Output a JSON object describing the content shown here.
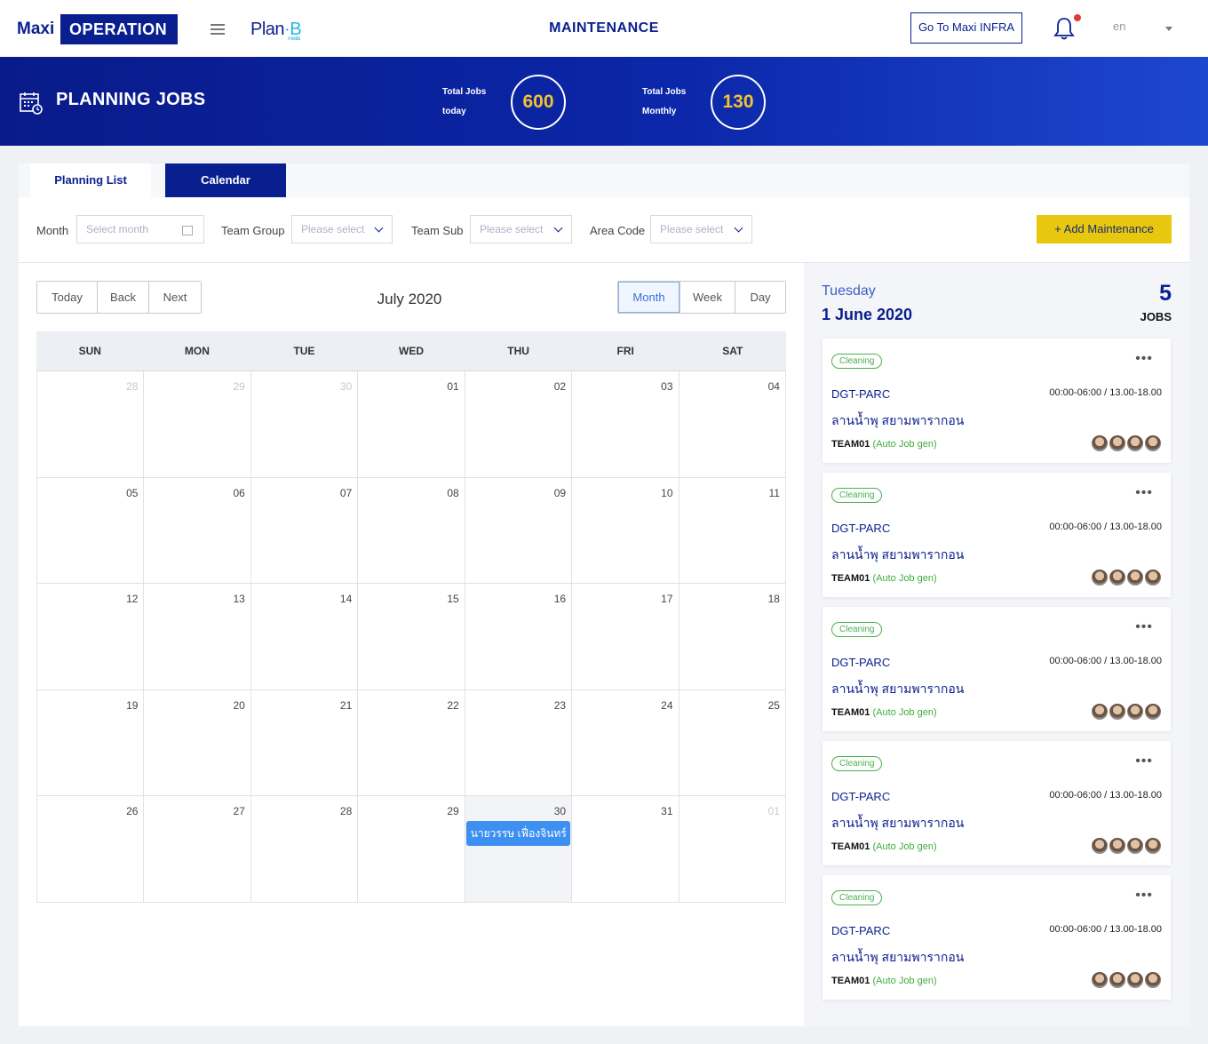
{
  "header": {
    "brand_maxi": "Maxi",
    "brand_operation": "OPERATION",
    "brand_planb": "Plan",
    "brand_planb_b": "B",
    "brand_planb_media": "media",
    "title": "MAINTENANCE",
    "infra_button": "Go To Maxi INFRA",
    "language": "en"
  },
  "banner": {
    "title": "PLANNING JOBS",
    "stats": [
      {
        "label_1": "Total Jobs",
        "label_2": "today",
        "value": "600"
      },
      {
        "label_1": "Total Jobs",
        "label_2": "Monthly",
        "value": "130"
      }
    ]
  },
  "tabs": [
    {
      "label": "Planning List"
    },
    {
      "label": "Calendar"
    }
  ],
  "filters": {
    "month_label": "Month",
    "month_placeholder": "Select month",
    "team_group_label": "Team  Group",
    "team_group_value": "Please  select",
    "team_sub_label": "Team  Sub",
    "team_sub_value": "Please  select",
    "area_code_label": "Area  Code",
    "area_code_value": "Please  select",
    "add_button": "+  Add Maintenance"
  },
  "calendar": {
    "nav": [
      "Today",
      "Back",
      "Next"
    ],
    "title": "July  2020",
    "views": [
      "Month",
      "Week",
      "Day"
    ],
    "active_view": "Month",
    "weekdays": [
      "SUN",
      "MON",
      "TUE",
      "WED",
      "THU",
      "FRI",
      "SAT"
    ],
    "weeks": [
      [
        "28",
        "29",
        "30",
        "01",
        "02",
        "03",
        "04"
      ],
      [
        "05",
        "06",
        "07",
        "08",
        "09",
        "10",
        "11"
      ],
      [
        "12",
        "13",
        "14",
        "15",
        "16",
        "17",
        "18"
      ],
      [
        "19",
        "20",
        "21",
        "22",
        "23",
        "24",
        "25"
      ],
      [
        "26",
        "27",
        "28",
        "29",
        "30",
        "31",
        "01"
      ]
    ],
    "event": "นายวรรษ เฟื่องจินทร์"
  },
  "side": {
    "day_name": "Tuesday",
    "date": "1  June  2020",
    "count": "5",
    "count_label": "JOBS",
    "jobs": [
      {
        "tag": "Cleaning",
        "code": "DGT-PARC",
        "time": "00:00-06:00  /  13.00-18.00",
        "location": "ลานน้ำพุ  สยามพารากอน",
        "team": "TEAM01",
        "auto": "(Auto  Job  gen)"
      },
      {
        "tag": "Cleaning",
        "code": "DGT-PARC",
        "time": "00:00-06:00  /  13.00-18.00",
        "location": "ลานน้ำพุ  สยามพารากอน",
        "team": "TEAM01",
        "auto": "(Auto  Job  gen)"
      },
      {
        "tag": "Cleaning",
        "code": "DGT-PARC",
        "time": "00:00-06:00  /  13.00-18.00",
        "location": "ลานน้ำพุ  สยามพารากอน",
        "team": "TEAM01",
        "auto": "(Auto  Job  gen)"
      },
      {
        "tag": "Cleaning",
        "code": "DGT-PARC",
        "time": "00:00-06:00  /  13.00-18.00",
        "location": "ลานน้ำพุ  สยามพารากอน",
        "team": "TEAM01",
        "auto": "(Auto  Job  gen)"
      },
      {
        "tag": "Cleaning",
        "code": "DGT-PARC",
        "time": "00:00-06:00  /  13.00-18.00",
        "location": "ลานน้ำพุ  สยามพารากอน",
        "team": "TEAM01",
        "auto": "(Auto  Job  gen)"
      }
    ]
  },
  "colors": {
    "brand_navy": "#0a1f8f",
    "accent_yellow": "#e8c80e",
    "event_blue": "#3d8ff2",
    "tag_green": "#4caf50"
  }
}
